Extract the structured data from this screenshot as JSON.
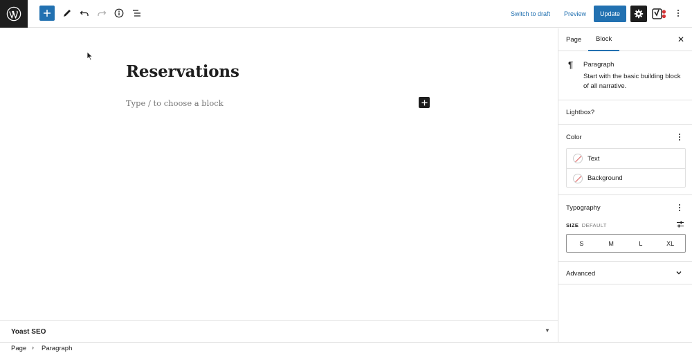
{
  "toolbar": {
    "switch_to_draft": "Switch to draft",
    "preview": "Preview",
    "update": "Update",
    "accent": "#2271b1"
  },
  "editor": {
    "title": "Reservations",
    "placeholder": "Type / to choose a block"
  },
  "yoast_panel": {
    "title": "Yoast SEO"
  },
  "breadcrumb": {
    "items": [
      "Page",
      "Paragraph"
    ]
  },
  "sidebar": {
    "tabs": [
      {
        "label": "Page",
        "active": false
      },
      {
        "label": "Block",
        "active": true
      }
    ],
    "block_card": {
      "title": "Paragraph",
      "description": "Start with the basic building block of all narrative."
    },
    "lightbox": {
      "label": "Lightbox?"
    },
    "color": {
      "title": "Color",
      "items": [
        {
          "label": "Text"
        },
        {
          "label": "Background"
        }
      ]
    },
    "typography": {
      "title": "Typography",
      "size_label": "SIZE",
      "size_default": "DEFAULT",
      "sizes": [
        "S",
        "M",
        "L",
        "XL"
      ]
    },
    "advanced": {
      "title": "Advanced"
    }
  }
}
